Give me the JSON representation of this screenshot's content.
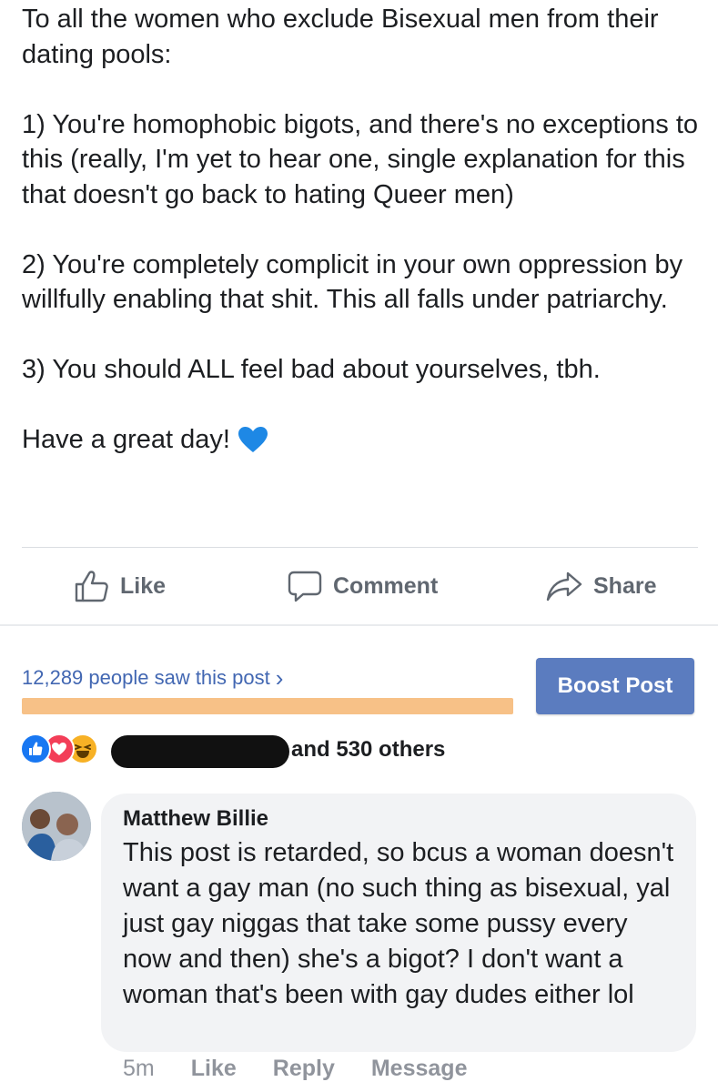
{
  "post": {
    "paragraphs": [
      "To all the women who exclude Bisexual men from their dating pools:",
      "1) You're homophobic bigots, and there's no exceptions to this (really, I'm yet to hear one, single explanation for this that doesn't go back to hating Queer men)",
      "2) You're completely complicit in your own oppression by willfully enabling that shit. This all falls under patriarchy.",
      "3) You should ALL feel bad about yourselves, tbh.",
      "Have a great day!"
    ],
    "emoji": "blue-heart-icon"
  },
  "actions": {
    "like": "Like",
    "comment": "Comment",
    "share": "Share"
  },
  "reach": {
    "text": "12,289 people saw this post",
    "chevron": "›",
    "progress": 1.0,
    "progress_color": "#f7c187"
  },
  "boost": {
    "label": "Boost Post",
    "color": "#5b7cbf"
  },
  "reactions": {
    "icons": [
      "like-reaction-icon",
      "love-reaction-icon",
      "haha-reaction-icon"
    ],
    "others_text": "and 530 others"
  },
  "comment": {
    "author": "Matthew Billie",
    "text": "This post is retarded, so bcus a woman doesn't want a gay man (no such thing as bisexual, yal just gay niggas that take some pussy every now and then) she's a bigot? I don't want a woman that's been with gay dudes either lol",
    "time": "5m",
    "like": "Like",
    "reply": "Reply",
    "message": "Message"
  },
  "colors": {
    "link": "#4267b2",
    "muted": "#606770",
    "bubble": "#f2f3f5"
  }
}
